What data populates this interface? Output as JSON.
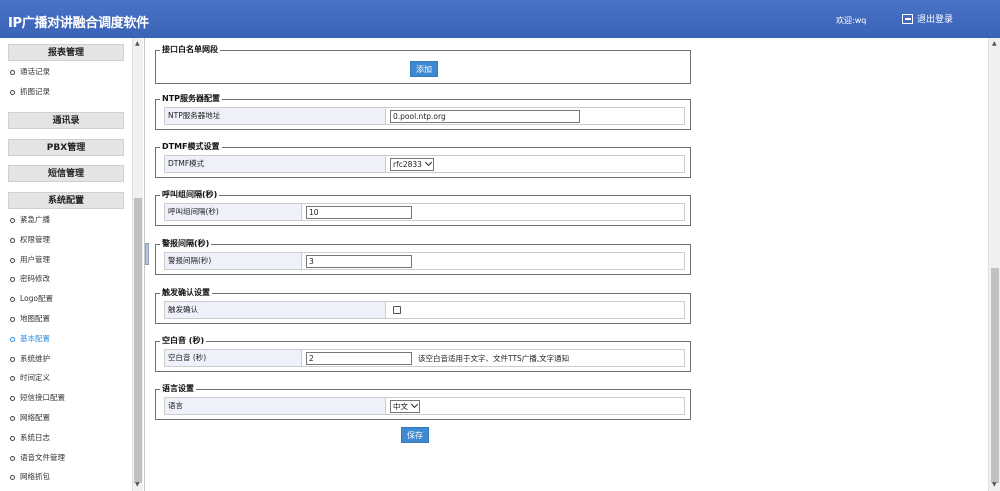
{
  "header": {
    "title": "IP广播对讲融合调度软件",
    "welcome": "欢迎:wq",
    "logout_label": "退出登录"
  },
  "sidebar": {
    "groups": [
      {
        "label": "报表管理",
        "items": [
          "通话记录",
          "抓图记录"
        ]
      },
      {
        "label": "通讯录",
        "items": []
      },
      {
        "label": "PBX管理",
        "items": []
      },
      {
        "label": "短信管理",
        "items": []
      },
      {
        "label": "系统配置",
        "items": [
          "紧急广播",
          "权限管理",
          "用户管理",
          "密码修改",
          "Logo配置",
          "地图配置",
          "基本配置",
          "系统维护",
          "时间定义",
          "短信接口配置",
          "网络配置",
          "系统日志",
          "语音文件管理",
          "网络抓包"
        ]
      }
    ],
    "active_item": "基本配置"
  },
  "sections": {
    "whitelist": {
      "legend": "接口白名单网段",
      "add_label": "添加"
    },
    "ntp": {
      "legend": "NTP服务器配置",
      "label": "NTP服务器地址",
      "value": "0.pool.ntp.org"
    },
    "dtmf": {
      "legend": "DTMF模式设置",
      "label": "DTMF模式",
      "value": "rfc2833"
    },
    "call_interval": {
      "legend": "呼叫组间隔(秒)",
      "label": "呼叫组间隔(秒)",
      "value": "10"
    },
    "alarm_interval": {
      "legend": "警报间隔(秒)",
      "label": "警报间隔(秒)",
      "value": "3"
    },
    "trigger_confirm": {
      "legend": "触发确认设置",
      "label": "触发确认",
      "checked": false
    },
    "blank_audio": {
      "legend": "空白音 (秒)",
      "label": "空白音 (秒)",
      "value": "2",
      "hint": "该空白音适用于文字、文件TTS广播,文字通知"
    },
    "language": {
      "legend": "语言设置",
      "label": "语言",
      "value": "中文"
    }
  },
  "save_label": "保存"
}
